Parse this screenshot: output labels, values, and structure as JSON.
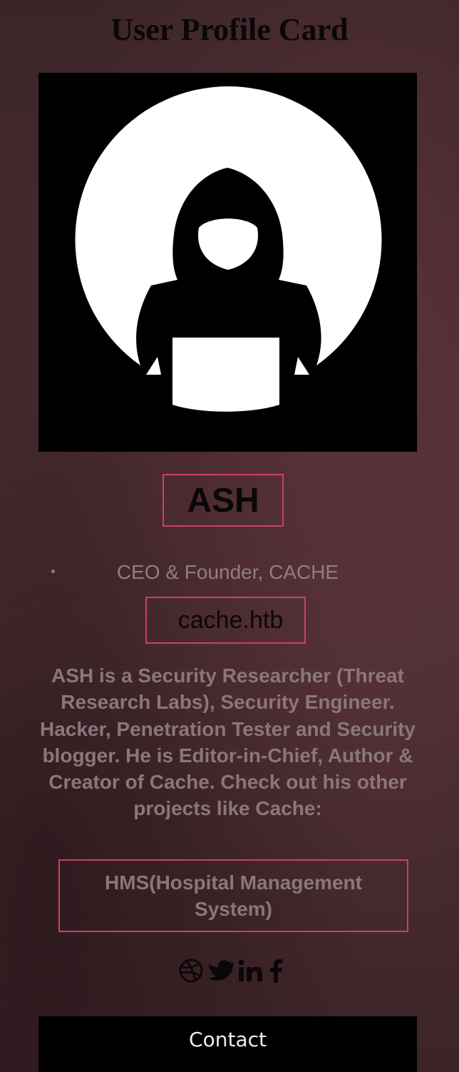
{
  "page": {
    "title": "User Profile Card"
  },
  "profile": {
    "avatar_icon": "hooded-hacker-icon",
    "name": "ASH",
    "role": "CEO & Founder, CACHE",
    "website": "cache.htb",
    "bio": "ASH is a Security Researcher (Threat Research Labs), Security Engineer. Hacker, Penetration Tester and Security blogger. He is Editor-in-Chief, Author & Creator of Cache. Check out his other projects like Cache:",
    "project": "HMS(Hospital Management System)"
  },
  "social": [
    {
      "icon": "dribbble-icon"
    },
    {
      "icon": "twitter-icon"
    },
    {
      "icon": "linkedin-icon"
    },
    {
      "icon": "facebook-icon"
    }
  ],
  "contact": {
    "label": "Contact"
  },
  "colors": {
    "accent_border": "#c8416b",
    "card_text": "#8a777b",
    "dark_text": "#0b0708",
    "button_bg": "#000000",
    "button_text": "#f2eced"
  }
}
